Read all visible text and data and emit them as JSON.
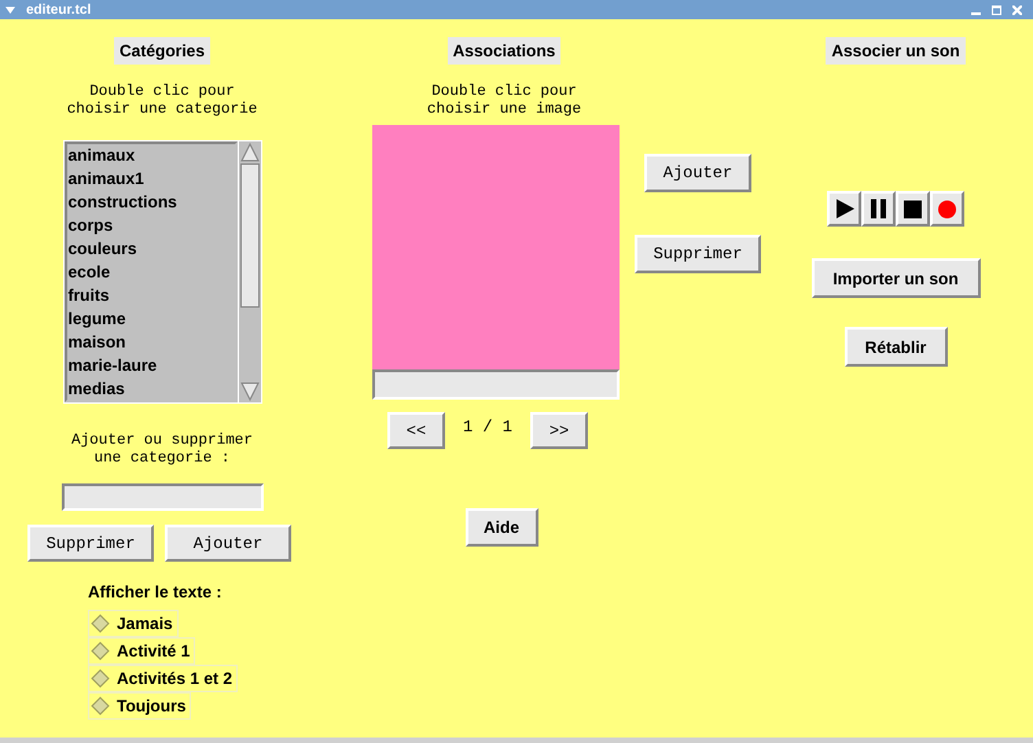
{
  "window": {
    "title": "editeur.tcl"
  },
  "categories": {
    "heading": "Catégories",
    "hint": [
      "Double clic pour",
      "choisir une categorie"
    ],
    "items": [
      "animaux",
      "animaux1",
      "constructions",
      "corps",
      "couleurs",
      "ecole",
      "fruits",
      "legume",
      "maison",
      "marie-laure",
      "medias"
    ],
    "edit_hint": [
      "Ajouter ou supprimer",
      "une categorie :"
    ],
    "buttons": [
      "Supprimer",
      "Ajouter"
    ]
  },
  "show_text": {
    "label": "Afficher le texte :",
    "options": [
      {
        "label": "Jamais",
        "selected": false
      },
      {
        "label": "Activité 1",
        "selected": false
      },
      {
        "label": "Activités 1 et 2",
        "selected": false
      },
      {
        "label": "Toujours",
        "selected": false
      }
    ]
  },
  "associations": {
    "heading": "Associations",
    "hint": [
      "Double clic pour",
      "choisir une image"
    ],
    "add_button": "Ajouter",
    "remove_button": "Supprimer",
    "prev_button": "<<",
    "page": "1 / 1",
    "next_button": ">>",
    "help_button": "Aide"
  },
  "sound": {
    "heading": "Associer un son",
    "controls": [
      {
        "kind": "play"
      },
      {
        "kind": "pause"
      },
      {
        "kind": "stop"
      },
      {
        "kind": "record"
      }
    ],
    "import_button": "Importer un son",
    "reset_button": "Rétablir"
  }
}
